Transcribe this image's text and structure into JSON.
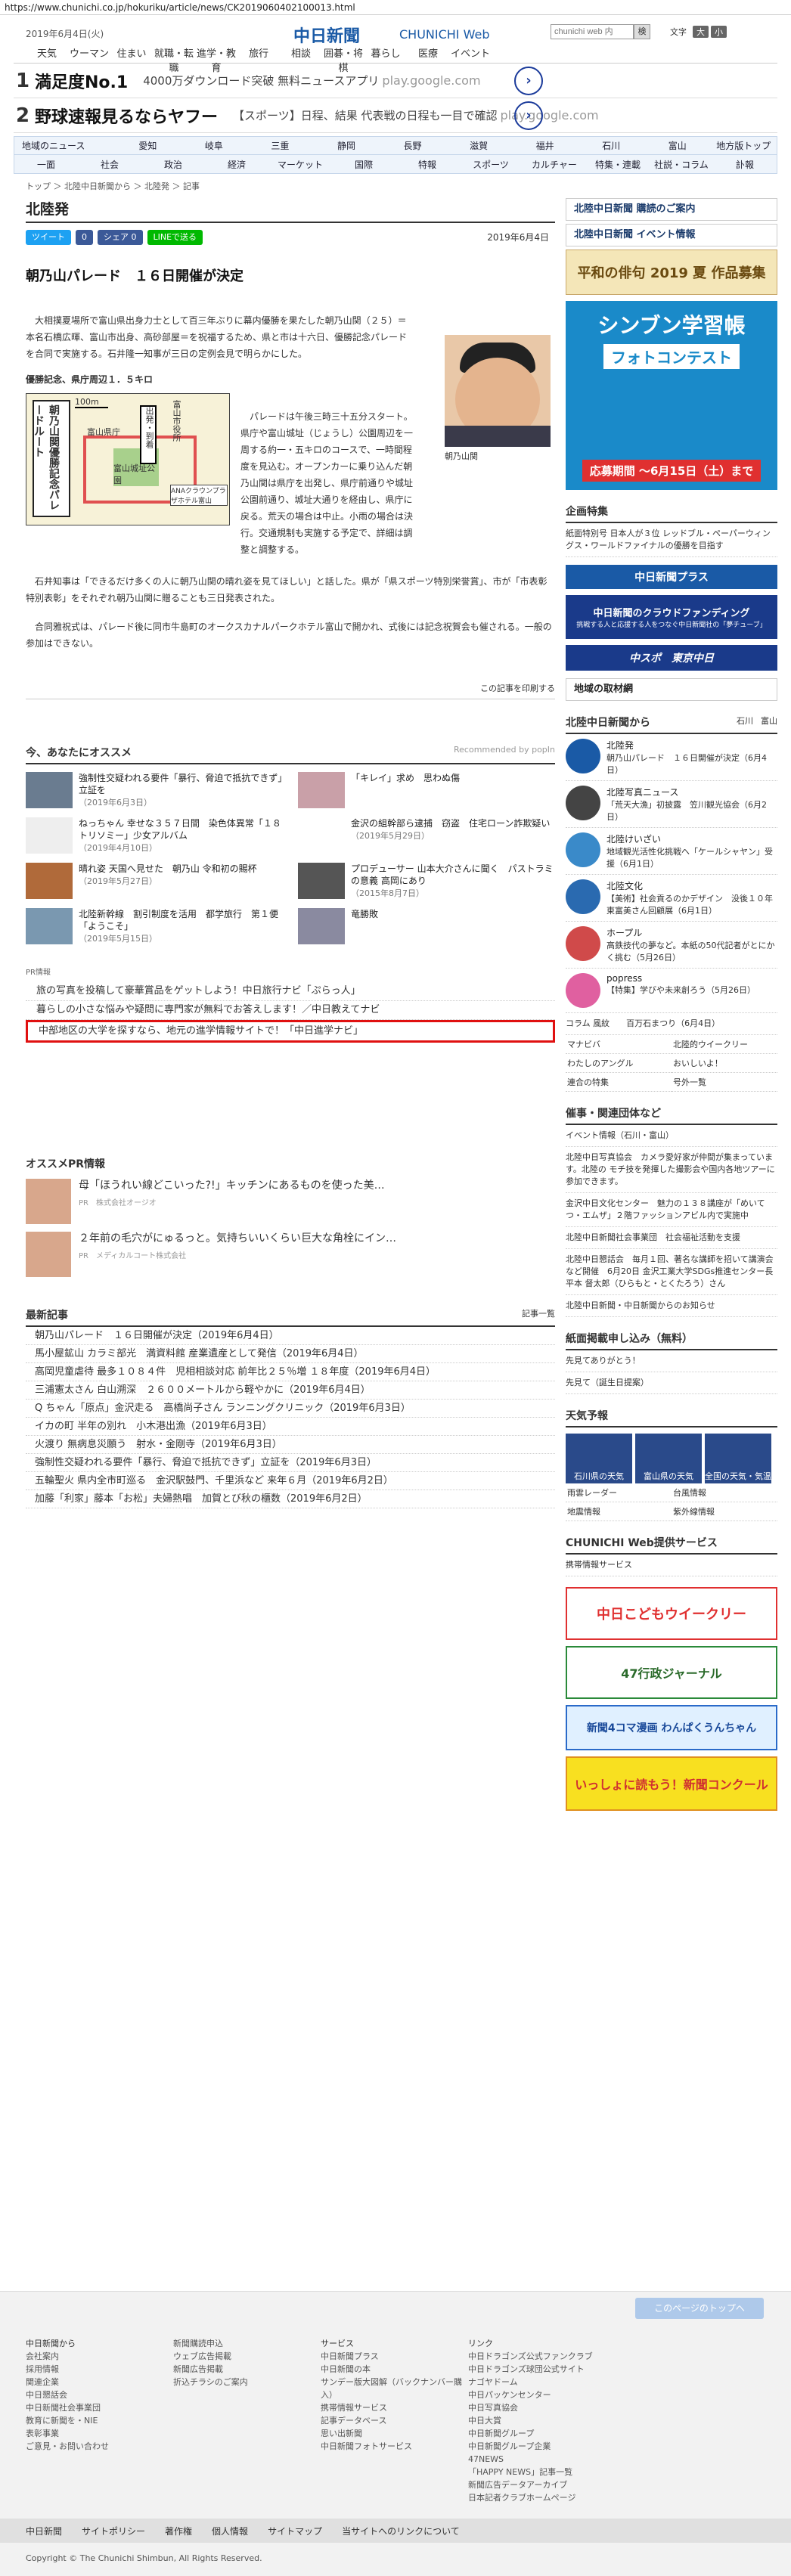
{
  "url": "https://www.chunichi.co.jp/hokuriku/article/news/CK2019060402100013.html",
  "header": {
    "date": "2019年6月4日(火)",
    "logo": "中日新聞",
    "logo_sub": "CHUNICHI Web",
    "search_placeholder": "chunichi web 内",
    "search_btn": "検",
    "font_label": "文字",
    "font_sizes": [
      "大",
      "小"
    ],
    "nav": [
      "天気",
      "ウーマン",
      "住まい",
      "就職・転職",
      "進学・教育",
      "旅行",
      "相談",
      "囲碁・将棋",
      "暮らし",
      "医療",
      "イベント"
    ]
  },
  "ads": [
    {
      "num": "1",
      "big": "満足度No.1",
      "sub": "4000万ダウンロード突破 無料ニュースアプリ",
      "dom": "play.google.com"
    },
    {
      "num": "2",
      "big": "野球速報見るならヤフー",
      "sub": "【スポーツ】日程、結果 代表戦の日程も一目で確認",
      "dom": "play.google.com"
    }
  ],
  "region_nav": {
    "row1": [
      "地域のニュース",
      "愛知",
      "岐阜",
      "三重",
      "静岡",
      "長野",
      "滋賀",
      "福井",
      "石川",
      "富山",
      "地方版トップ"
    ],
    "row2": [
      "一面",
      "社会",
      "政治",
      "経済",
      "マーケット",
      "国際",
      "特報",
      "スポーツ",
      "カルチャー",
      "特集・連載",
      "社説・コラム",
      "訃報"
    ]
  },
  "breadcrumb": "トップ ＞ 北陸中日新聞から ＞ 北陸発 ＞ 記事",
  "section_title": "北陸発",
  "share": {
    "tweet": "ツイート",
    "fb": "0",
    "share": "シェア 0",
    "line": "LINEで送る",
    "date": "2019年6月4日"
  },
  "article": {
    "title": "朝乃山パレード　１６日開催が決定",
    "p1": "　大相撲夏場所で富山県出身力士として百三年ぶりに幕内優勝を果たした朝乃山関（２５）＝本名石橋広暉、富山市出身、高砂部屋＝を祝福するため、県と市は十六日、優勝記念パレードを合同で実施する。石井隆一知事が三日の定例会見で明らかにした。",
    "subhead": "優勝記念、県庁周辺１．５キロ",
    "p2": "　パレードは午後三時三十五分スタート。県庁や富山城址（じょうし）公園周辺を一周する約一・五キロのコースで、一時間程度を見込む。オープンカーに乗り込んだ朝乃山関は県庁を出発し、県庁前通りや城址公園前通り、城址大通りを経由し、県庁に戻る。荒天の場合は中止。小雨の場合は決行。交通規制も実施する予定で、詳細は調整と調整する。",
    "p3": "　石井知事は「できるだけ多くの人に朝乃山関の晴れ姿を見てほしい」と話した。県が「県スポーツ特別栄誉賞」、市が「市表彰特別表彰」をそれぞれ朝乃山関に贈ることも三日発表された。",
    "p4": "　合同雅祝式は、パレード後に同市牛島町のオークスカナルパークホテル富山で開かれ、式後には記念祝賀会も催される。一般の参加はできない。",
    "photo_caption": "朝乃山関",
    "map_title": "朝乃山関優勝記念パレードルート",
    "map_scale": "100m",
    "map_labels": [
      "出発・到着",
      "富山県庁",
      "富山城址公園",
      "富山市役所",
      "ANAクラウンプラザホテル富山"
    ],
    "print_link": "この記事を印刷する"
  },
  "recommend": {
    "title": "今、あなたにオススメ",
    "by": "Recommended by popIn",
    "items": [
      {
        "t": "強制性交疑われる要件「暴行、脅迫で抵抗できず」立証を",
        "d": "（2019年6月3日）",
        "c": "#6a7c90"
      },
      {
        "t": "「キレイ」求め　思わぬ傷",
        "d": "",
        "c": "#c9a0a8"
      },
      {
        "t": "ねっちゃん 幸せな３５７日間　染色体異常「１８トリソミー」少女アルバム",
        "d": "（2019年4月10日）",
        "c": "#eee"
      },
      {
        "t": "金沢の組幹部ら逮捕　窃盗　住宅ローン詐欺疑い",
        "d": "（2019年5月29日）",
        "c": "#ffffff"
      },
      {
        "t": "晴れ姿 天国へ見せた　朝乃山 令和初の賜杯",
        "d": "（2019年5月27日）",
        "c": "#b06a3a"
      },
      {
        "t": "プロデューサー 山本大介さんに聞く　パストラミの意義 高岡にあり",
        "d": "（2015年8月7日）",
        "c": "#555"
      },
      {
        "t": "北陸新幹線　割引制度を活用　都学旅行　第１便「ようこそ」",
        "d": "（2019年5月15日）",
        "c": "#7a98b0"
      },
      {
        "t": "竜勝敗",
        "d": "",
        "c": "#8a8aa0"
      }
    ]
  },
  "pr": {
    "label": "PR情報",
    "links": [
      "旅の写真を投稿して豪華賞品をゲットしよう！中日旅行ナビ「ぷらっ人」",
      "暮らしの小さな悩みや疑問に専門家が無料でお答えします！／中日教えてナビ",
      "中部地区の大学を探すなら、地元の進学情報サイトで！「中日進学ナビ」"
    ]
  },
  "osusume_pr": {
    "title": "オススメPR情報",
    "items": [
      {
        "t": "母「ほうれい線どこいった?!」キッチンにあるものを使った美…",
        "s": "PR　株式会社オージオ"
      },
      {
        "t": "２年前の毛穴がにゅるっと。気持ちいいくらい巨大な角栓にイン…",
        "s": "PR　メディカルコート株式会社"
      }
    ]
  },
  "latest": {
    "title": "最新記事",
    "all": "記事一覧",
    "items": [
      "朝乃山パレード　１６日開催が決定（2019年6月4日）",
      "馬小屋鉱山 カラミ部光　満資料館 産業遺産として発信（2019年6月4日）",
      "高岡児童虐待 最多１０８４件　児相相談対応 前年比２５％増 １８年度（2019年6月4日）",
      "三浦憲太さん 白山溯深　２６００メートルから軽やかに（2019年6月4日）",
      "Q ちゃん「原点」金沢走る　高橋尚子さん ランニングクリニック（2019年6月3日）",
      "イカの町 半年の別れ　小木港出漁（2019年6月3日）",
      "火渡り 無病息災願う　射水・金剛寺（2019年6月3日）",
      "強制性交疑われる要件「暴行、脅迫で抵抗できず」立証を（2019年6月3日）",
      "五輪聖火 県内全市町巡る　金沢駅鼓門、千里浜など 来年６月（2019年6月2日）",
      "加藤「利家」藤本「お松」夫婦熱唱　加賀とび秋の櫃数（2019年6月2日）"
    ]
  },
  "side": {
    "buttons": [
      "北陸中日新聞 購読のご案内",
      "北陸中日新聞 イベント情報"
    ],
    "haiku": "平和の俳句 2019 夏 作品募集",
    "contest_title": "シンブン学習帳",
    "contest_sub": "フォトコンテスト",
    "contest_period": "応募期間 ～6月15日（土）まで",
    "kigyo_title": "企画特集",
    "kigyo_text": "紙面特別号 日本人が３位 レッドブル・ペーパーウィングス・ワールドファイナルの優勝を目指す",
    "plus": "中日新聞プラス",
    "crowd": "中日新聞のクラウドファンディング",
    "crowd_sub": "挑戦する人と応援する人をつなぐ中日新聞社の「夢チューブ」",
    "chunispo": "中スポ　東京中日",
    "chiiki": "地域の取材網",
    "from_title": "北陸中日新聞から",
    "from_tabs": [
      "石川",
      "富山"
    ],
    "from_items": [
      {
        "h": "北陸発",
        "b": "朝乃山パレード　１６日開催が決定（6月4日）",
        "c": "#1a5aa6"
      },
      {
        "h": "北陸写真ニュース",
        "b": "「荒天大漁」初披露　笠川観光協会（6月2日）",
        "c": "#444"
      },
      {
        "h": "北陸けいざい",
        "b": "地域観光活性化挑戦へ「ケールシャヤン」受援（6月1日）",
        "c": "#3a8ac9"
      },
      {
        "h": "北陸文化",
        "b": "【美術】社会貢るのかデザイン　没後１０年 東富美さん回顧展（6月1日）",
        "c": "#2a6ab0"
      },
      {
        "h": "ホープル",
        "b": "高鉄技代の夢など。本紙の50代記者がとにかく挑む（5月26日）",
        "c": "#d04a4a"
      },
      {
        "h": "popress",
        "b": "【特集】学びや未来創ろう（5月26日）",
        "c": "#e060a0"
      }
    ],
    "column": "コラム 風紋　　百万石まつり（6月4日）",
    "links": [
      "マナビバ",
      "北陸的ウイークリー",
      "わたしのアングル",
      "おいしいよ！",
      "連合の特集",
      "号外一覧"
    ],
    "events_title": "催事・関連団体など",
    "events": [
      "イベント情報（石川・富山）",
      "北陸中日写真協会　カメラ愛好家が仲間が集まっています。北陸の モチ技を発揮した撮影会や国内各地ツアーに参加できます。",
      "金沢中日文化センター　魅力の１３８講座が「めいてつ・エムザ」２階ファッションアビル内で実施中",
      "北陸中日新聞社会事業団　社会福祉活動を支援",
      "北陸中日懇話会　毎月１回、著名な講師を招いて講演会など開催　6月20日 金沢工業大学SDGs推進センター長 平本 督太郎（ひらもと・とくたろう）さん",
      "北陸中日新聞・中日新聞からのお知らせ"
    ],
    "shimen_title": "紙面掲載申し込み（無料）",
    "shimen": [
      "先見てありがとう！",
      "先見て（誕生日提案）"
    ],
    "weather_title": "天気予報",
    "weather": [
      "石川県の天気",
      "富山県の天気",
      "全国の天気・気温"
    ],
    "weather_links": [
      "雨雲レーダー",
      "台風情報",
      "地震情報",
      "紫外線情報"
    ],
    "service_title": "CHUNICHI Web提供サービス",
    "service_link": "携帯情報サービス",
    "b1": "中日こどもウイークリー",
    "b2": "47行政ジャーナル",
    "b3": "新聞4コマ漫画 わんぱくうんちゃん",
    "b4": "いっしょに読もう！新聞コンクール"
  },
  "footer": {
    "totop": "このページのトップへ",
    "cols": [
      [
        "中日新聞から",
        "会社案内",
        "採用情報",
        "関連企業",
        "中日懇話会",
        "中日新聞社会事業団",
        "教育に新聞を・NIE",
        "表彰事業",
        "ご意見・お問い合わせ"
      ],
      [
        "",
        "新聞購読申込",
        "ウェブ広告掲載",
        "新聞広告掲載",
        "折込チラシのご案内"
      ],
      [
        "サービス",
        "中日新聞プラス",
        "中日新聞の本",
        "サンデー版大図解（バックナンバー購入）",
        "携帯情報サービス",
        "記事データベース",
        "思い出新聞",
        "中日新聞フォトサービス"
      ],
      [
        "リンク",
        "中日ドラゴンズ公式ファンクラブ",
        "中日ドラゴンズ球団公式サイト",
        "ナゴヤドーム",
        "中日パッケンセンター",
        "中日写真協会",
        "中日大賞",
        "中日新聞グループ",
        "中日新聞グループ企業",
        "47NEWS",
        "「HAPPY NEWS」記事一覧",
        "新聞広告データアーカイブ",
        "日本記者クラブホームページ"
      ]
    ],
    "bar": [
      "中日新聞",
      "サイトポリシー",
      "著作権",
      "個人情報",
      "サイトマップ",
      "当サイトへのリンクについて"
    ],
    "copy": "Copyright © The Chunichi Shimbun, All Rights Reserved."
  }
}
